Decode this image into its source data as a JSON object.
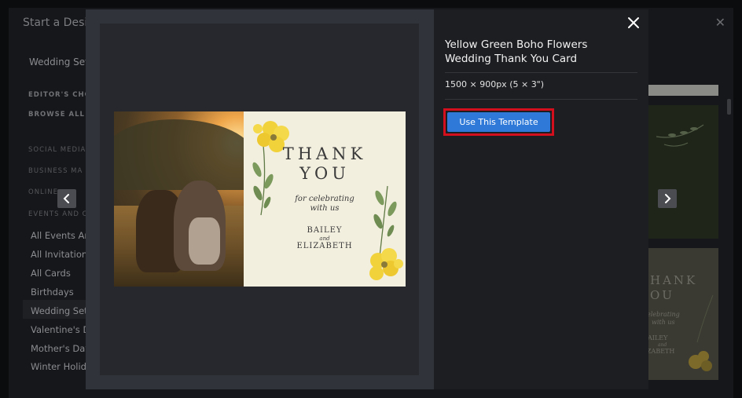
{
  "background": {
    "title": "Start a Desig",
    "close_icon": "close-icon",
    "sidebar": {
      "title": "Wedding Set",
      "captions": [
        "EDITOR'S CHO",
        "BROWSE ALL T"
      ],
      "group_captions": [
        "SOCIAL MEDIA",
        "BUSINESS MA",
        "ONLINE ",
        "EVENTS AND C"
      ],
      "items": [
        "All Events Ar",
        "All Invitation",
        "All Cards",
        "Birthdays",
        "Wedding Set",
        "Valentine's D",
        "Mother's Day",
        "Winter Holid"
      ],
      "active_index": 4
    },
    "card2_text": [
      "HANK",
      "OU",
      "elebrating",
      "with us",
      "AILEY",
      "and",
      "ZABETH"
    ]
  },
  "modal": {
    "template_title": "Yellow Green Boho Flowers Wedding Thank You Card",
    "template_size": "1500 × 900px (5 × 3\")",
    "use_button_label": "Use This Template",
    "close_icon": "close-icon",
    "prev_icon": "chevron-left-icon",
    "next_icon": "chevron-right-icon",
    "card": {
      "line1": "THANK",
      "line2": "YOU",
      "line3": "for celebrating",
      "line4": "with us",
      "name1": "BAILEY",
      "and": "and",
      "name2": "ELIZABETH"
    }
  },
  "colors": {
    "accent_button": "#2f7ad8",
    "highlight_outline": "#d30f1e",
    "card_background": "#f3efdf",
    "flower_yellow": "#f2d23a"
  }
}
